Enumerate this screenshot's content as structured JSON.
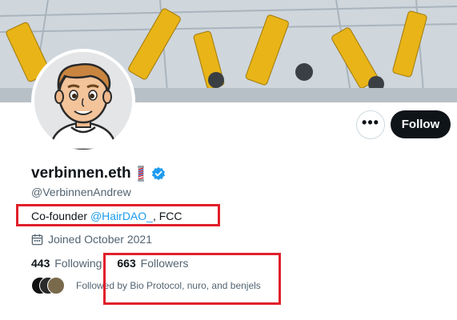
{
  "profile": {
    "display_name": "verbinnen.eth",
    "handle": "@VerbinnenAndrew",
    "bio_prefix": "Co-founder ",
    "bio_mention": "@HairDAO_",
    "bio_suffix": ", FCC",
    "joined": "Joined October 2021"
  },
  "actions": {
    "more": "•••",
    "follow": "Follow"
  },
  "stats": {
    "following_count": "443",
    "following_label": "Following",
    "followers_count": "663",
    "followers_label": "Followers"
  },
  "followed_by": "Followed by Bio Protocol, nuro, and benjels",
  "colors": {
    "accent": "#1d9bf0",
    "text_primary": "#0f1419",
    "text_secondary": "#536471",
    "annotation": "#e0202a"
  },
  "icons": {
    "verified": "verified-badge-icon",
    "barber_pole": "barber-pole-icon",
    "calendar": "calendar-icon",
    "more": "more-icon"
  }
}
